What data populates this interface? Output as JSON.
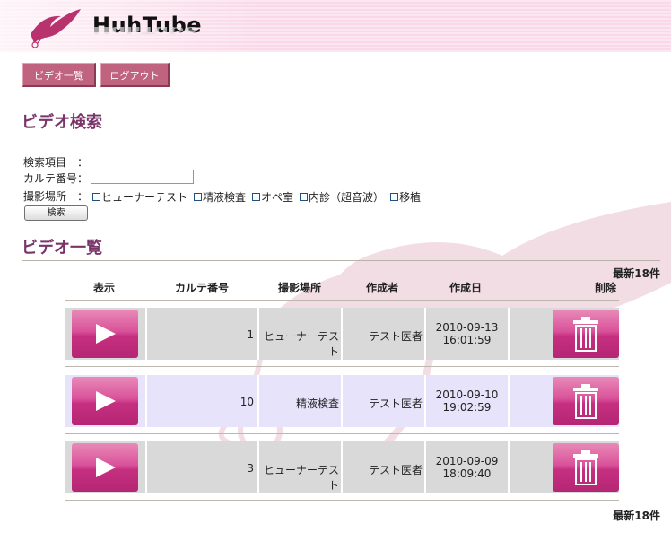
{
  "app": {
    "title": "HuhTube"
  },
  "nav": {
    "video_list": "ビデオ一覧",
    "logout": "ログアウト"
  },
  "search": {
    "title": "ビデオ検索",
    "items_label": "検索項目　：",
    "chart_no_label": "カルテ番号：",
    "chart_no_value": "",
    "location_label": "撮影場所　：",
    "locations": [
      "ヒューナーテスト",
      "精液検査",
      "オペ室",
      "内診（超音波）",
      "移植"
    ],
    "button": "検索"
  },
  "list": {
    "title": "ビデオ一覧",
    "count_text": "最新18件",
    "headers": {
      "show": "表示",
      "chart_no": "カルテ番号",
      "location": "撮影場所",
      "author": "作成者",
      "created": "作成日",
      "delete": "削除"
    },
    "rows": [
      {
        "chart_no": "1",
        "location": "ヒューナーテスト",
        "author": "テスト医者",
        "date": "2010-09-13",
        "time": "16:01:59"
      },
      {
        "chart_no": "10",
        "location": "精液検査",
        "author": "テスト医者",
        "date": "2010-09-10",
        "time": "19:02:59"
      },
      {
        "chart_no": "3",
        "location": "ヒューナーテスト",
        "author": "テスト医者",
        "date": "2010-09-09",
        "time": "18:09:40"
      }
    ]
  },
  "colors": {
    "accent": "#7a3468",
    "button": "#c0637f",
    "row_gray": "#d9d9d9",
    "row_lilac": "#e6e3fb"
  },
  "icons": {
    "play": "play-icon",
    "delete": "trash-icon",
    "logo": "crane-logo-icon"
  }
}
